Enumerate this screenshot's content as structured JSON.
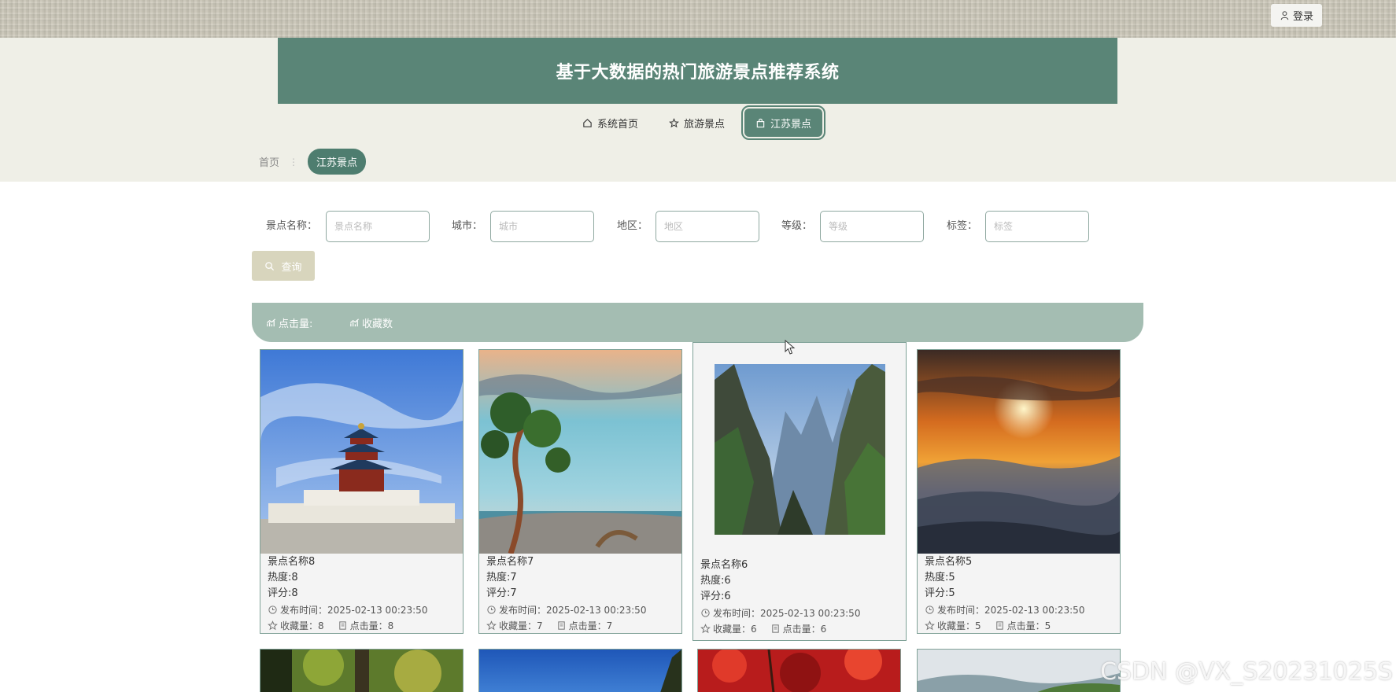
{
  "header": {
    "login_label": "登录",
    "title": "基于大数据的热门旅游景点推荐系统"
  },
  "nav": {
    "items": [
      {
        "label": "系统首页",
        "icon": "home-icon"
      },
      {
        "label": "旅游景点",
        "icon": "star-icon"
      },
      {
        "label": "江苏景点",
        "icon": "bag-icon"
      }
    ],
    "active_index": 2
  },
  "breadcrumb": {
    "home": "首页",
    "current": "江苏景点"
  },
  "search": {
    "fields": [
      {
        "label": "景点名称：",
        "placeholder": "景点名称",
        "value": ""
      },
      {
        "label": "城市：",
        "placeholder": "城市",
        "value": ""
      },
      {
        "label": "地区：",
        "placeholder": "地区",
        "value": ""
      },
      {
        "label": "等级：",
        "placeholder": "等级",
        "value": ""
      },
      {
        "label": "标签：",
        "placeholder": "标签",
        "value": ""
      }
    ],
    "query_label": "查询"
  },
  "sort": {
    "clicks_label": "点击量:",
    "favorites_label": "收藏数"
  },
  "cards": [
    {
      "name": "景点名称8",
      "heat": "热度:8",
      "score": "评分:8",
      "publish": "发布时间：2025-02-13 00:23:50",
      "fav": "收藏量：8",
      "clicks": "点击量：8"
    },
    {
      "name": "景点名称7",
      "heat": "热度:7",
      "score": "评分:7",
      "publish": "发布时间：2025-02-13 00:23:50",
      "fav": "收藏量：7",
      "clicks": "点击量：7"
    },
    {
      "name": "景点名称6",
      "heat": "热度:6",
      "score": "评分:6",
      "publish": "发布时间：2025-02-13 00:23:50",
      "fav": "收藏量：6",
      "clicks": "点击量：6"
    },
    {
      "name": "景点名称5",
      "heat": "热度:5",
      "score": "评分:5",
      "publish": "发布时间：2025-02-13 00:23:50",
      "fav": "收藏量：5",
      "clicks": "点击量：5"
    }
  ],
  "watermark": "CSDN @VX_S20231025S",
  "colors": {
    "primary": "#5a8577",
    "header_bg": "#efefe7",
    "sort_bar": "#a4bdb2",
    "query_button": "#d8d5bd"
  }
}
